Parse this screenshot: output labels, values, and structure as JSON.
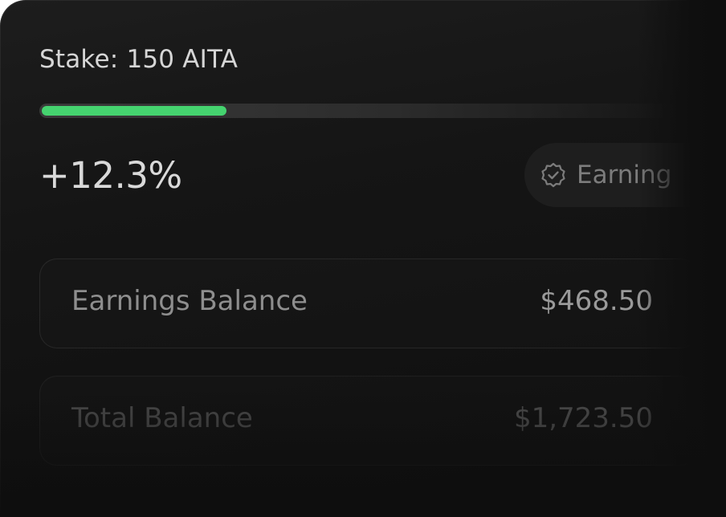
{
  "stake": {
    "label": "Stake: 150 AITA",
    "progress_fraction": 0.29,
    "progress_color": "#45d36f"
  },
  "performance": {
    "change": "+12.3%"
  },
  "status_pill": {
    "icon": "badge-check-icon",
    "label": "Earning"
  },
  "balances": [
    {
      "label": "Earnings Balance",
      "value": "$468.50"
    },
    {
      "label": "Total Balance",
      "value": "$1,723.50"
    }
  ],
  "colors": {
    "accent": "#45d36f",
    "card_background": "#151515"
  }
}
